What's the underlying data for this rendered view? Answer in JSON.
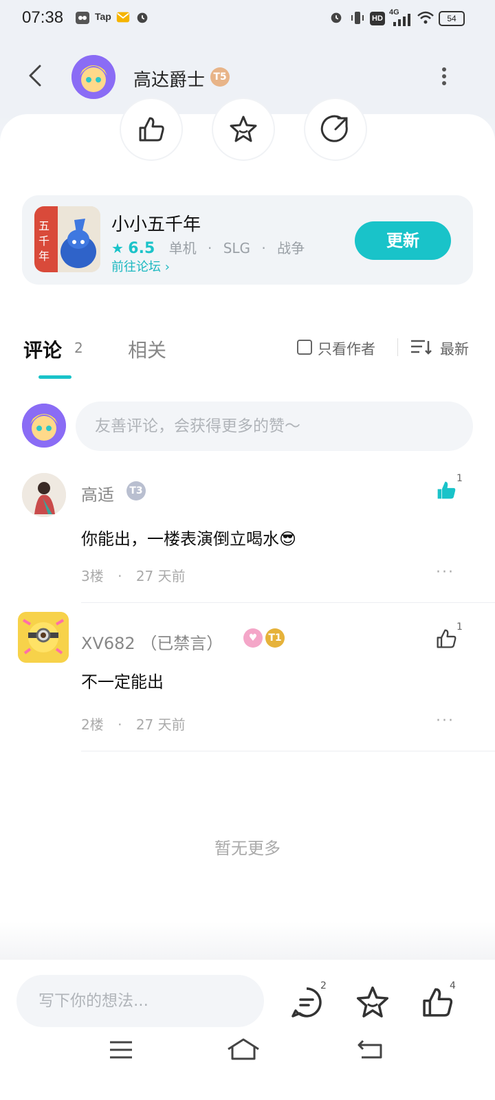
{
  "status_bar": {
    "time": "07:38",
    "tap_label": "Tap",
    "network": "4G",
    "hd": "HD",
    "battery": "54"
  },
  "header": {
    "username": "高达爵士",
    "level_badge": "T5",
    "back_icon": "chevron-left-icon",
    "menu_icon": "more-vertical-icon"
  },
  "actions": {
    "like_icon": "thumbs-up-icon",
    "favorite_icon": "star-icon",
    "share_icon": "share-icon"
  },
  "game": {
    "title": "小小五千年",
    "score": "6.5",
    "tags": [
      "单机",
      "SLG",
      "战争"
    ],
    "forum_link": "前往论坛",
    "update_button": "更新"
  },
  "tabs": {
    "comments_label": "评论",
    "comments_count": "2",
    "related_label": "相关",
    "only_author": "只看作者",
    "sort_label": "最新"
  },
  "comment_input": {
    "placeholder": "友善评论，会获得更多的赞～"
  },
  "comments": [
    {
      "name": "高适",
      "badge": "T3",
      "text": "你能出，一楼表演倒立喝水😎",
      "floor": "3楼",
      "time": "27 天前",
      "likes": "1",
      "liked": true
    },
    {
      "name": "XV682",
      "muted": "（已禁言）",
      "badge": "T1",
      "text": "不一定能出",
      "floor": "2楼",
      "time": "27 天前",
      "likes": "1",
      "liked": false
    }
  ],
  "no_more": "暂无更多",
  "bottom": {
    "input_placeholder": "写下你的想法...",
    "comment_count": "2",
    "like_count": "4"
  },
  "colors": {
    "accent": "#19c3c9",
    "background": "#eef1f6"
  }
}
